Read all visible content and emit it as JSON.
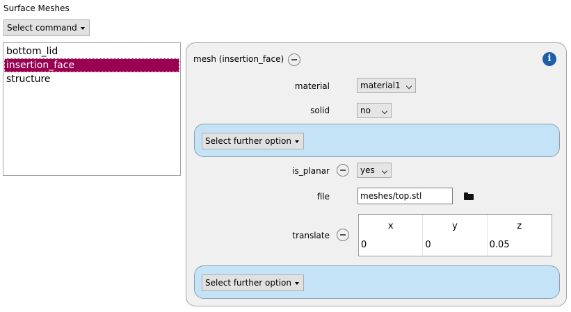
{
  "title": "Surface Meshes",
  "select_command": "Select command",
  "list": [
    "bottom_lid",
    "insertion_face",
    "structure"
  ],
  "panel": {
    "heading": "mesh (insertion_face)",
    "info_glyph": "i",
    "material_label": "material",
    "material_value": "material1",
    "solid_label": "solid",
    "solid_value": "no",
    "further_option": "Select further option",
    "is_planar_label": "is_planar",
    "is_planar_value": "yes",
    "file_label": "file",
    "file_value": "meshes/top.stl",
    "translate_label": "translate",
    "translate_headers": [
      "x",
      "y",
      "z"
    ],
    "translate_values": [
      "0",
      "0",
      "0.05"
    ],
    "further_option_2": "Select further option"
  },
  "colors": {
    "selection": "#990052",
    "option_box": "#c5e3f7",
    "info": "#1f5fa6"
  }
}
